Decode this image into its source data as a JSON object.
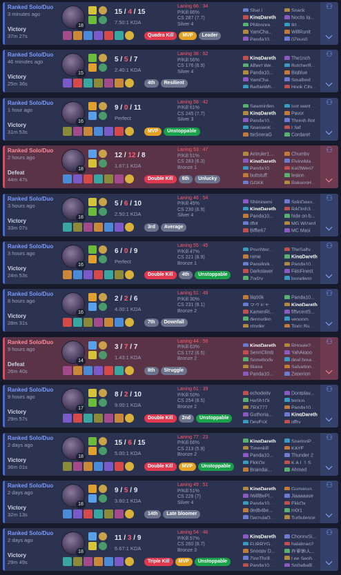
{
  "player_name": "KingDareth",
  "colors": {
    "win": "#4b6bd6",
    "loss": "#d84d62",
    "kill_badge": "#e0394f",
    "mvp_badge": "#e3a224",
    "positive_badge": "#1aa04a",
    "neutral_badge": "#6b728c"
  },
  "matches": [
    {
      "queue": "Ranked Solo/Duo",
      "ago": "3 minutes ago",
      "result": "Victory",
      "duration": "37m 27s",
      "level": "18",
      "k": "15",
      "d": "4",
      "a": "15",
      "kda": "7.50:1 KDA",
      "laning": "Laning 66 : 34",
      "pkill": "P/Kill 86%",
      "cs": "CS 287 (7.7)",
      "rank": "Silver 4",
      "badges": [
        {
          "t": "Quadra Kill",
          "c": "red"
        },
        {
          "t": "MVP",
          "c": "gold"
        },
        {
          "t": "Leader",
          "c": "grey"
        }
      ],
      "team1": [
        "ShaLi",
        "KingDareth",
        "Philosora...",
        "YamCha...",
        "Panda10..."
      ],
      "team2": [
        "Snack",
        "Noctis Ig...",
        "Ikt...",
        "WillRunIt",
        "0Zeus0"
      ]
    },
    {
      "queue": "Ranked Solo/Duo",
      "ago": "46 minutes ago",
      "result": "Victory",
      "duration": "25m 36s",
      "level": "15",
      "k": "5",
      "d": "5",
      "a": "7",
      "kda": "2.40:1 KDA",
      "laning": "Laning 38 : 62",
      "pkill": "P/Kill 56%",
      "cs": "CS 176 (6.9)",
      "rank": "Silver 4",
      "badges": [
        {
          "t": "4th",
          "c": "grey"
        },
        {
          "t": "Resilient",
          "c": "grey"
        }
      ],
      "team1": [
        "KingDareth",
        "Albert We...",
        "Panda10...",
        "YamCha...",
        "BarbieWh..."
      ],
      "team2": [
        "The1nch",
        "ButcherB...",
        "Bigblue",
        "Smallred",
        "Hook City..."
      ]
    },
    {
      "queue": "Ranked Solo/Duo",
      "ago": "1 hour ago",
      "result": "Victory",
      "duration": "31m 53s",
      "level": "16",
      "k": "9",
      "d": "0",
      "a": "11",
      "kda": "Perfect",
      "laning": "Laning 58 : 42",
      "pkill": "P/Kill 61%",
      "cs": "CS 245 (7.7)",
      "rank": "Silver 3",
      "badges": [
        {
          "t": "MVP",
          "c": "gold"
        },
        {
          "t": "Unstoppable",
          "c": "green"
        }
      ],
      "team1": [
        "Sawmirden",
        "KingDareth",
        "Panda10...",
        "SpanianK...",
        "tteSneraG"
      ],
      "team2": [
        "just want ...",
        "Pavor",
        "Thresh Bot",
        "L3af",
        "Cordaret"
      ]
    },
    {
      "queue": "Ranked Solo/Duo",
      "ago": "2 hours ago",
      "result": "Defeat",
      "duration": "44m 47s",
      "level": "18",
      "k": "12",
      "d": "12",
      "a": "8",
      "kda": "1.67:1 KDA",
      "laning": "Laning 53 : 47",
      "pkill": "P/Kill 51%",
      "cs": "CS 283 (6.3)",
      "rank": "Bronze 1",
      "badges": [
        {
          "t": "Double Kill",
          "c": "red"
        },
        {
          "t": "6th",
          "c": "grey"
        },
        {
          "t": "Unlucky",
          "c": "grey"
        }
      ],
      "team1": [
        "Antruler1...",
        "KingDareth",
        "Panda10...",
        "buttstuff",
        "GGKK"
      ],
      "team2": [
        "Chumby",
        "FlyingMa...",
        "Kai3Wen2",
        "legion",
        "RakansH..."
      ]
    },
    {
      "queue": "Ranked Solo/Duo",
      "ago": "3 hours ago",
      "result": "Victory",
      "duration": "33m 07s",
      "level": "18",
      "k": "5",
      "d": "6",
      "a": "10",
      "kda": "2.50:1 KDA",
      "laning": "Laning 46 : 54",
      "pkill": "P/Kill 45%",
      "cs": "CS 230 (6.9)",
      "rank": "Silver 4",
      "badges": [
        {
          "t": "3rd",
          "c": "grey"
        },
        {
          "t": "Average",
          "c": "grey"
        }
      ],
      "team1": [
        "Shiinigami",
        "KingDareth",
        "Panda10...",
        "dfgt",
        "Biffie67"
      ],
      "team2": [
        "SoloDaxu...",
        "RADish3...",
        "hide on b...",
        "MG Wizard",
        "MC Masi"
      ]
    },
    {
      "queue": "Ranked Solo/Duo",
      "ago": "3 hours ago",
      "result": "Victory",
      "duration": "24m 53s",
      "level": "16",
      "k": "6",
      "d": "0",
      "a": "9",
      "kda": "Perfect",
      "laning": "Laning 55 : 45",
      "pkill": "P/Kill 47%",
      "cs": "CS 221 (8.9)",
      "rank": "Bronze 1",
      "badges": [
        {
          "t": "Double Kill",
          "c": "red"
        },
        {
          "t": "4th",
          "c": "grey"
        },
        {
          "t": "Unstoppable",
          "c": "green"
        }
      ],
      "team1": [
        "Psychtec...",
        "rome",
        "Parwilork...",
        "Darkslayer",
        "Zodzy"
      ],
      "team2": [
        "TheSalty...",
        "KingDareth",
        "Panda10...",
        "FijisFinest",
        "looselegs"
      ]
    },
    {
      "queue": "Ranked Solo/Duo",
      "ago": "8 hours ago",
      "result": "Victory",
      "duration": "28m 31s",
      "level": "16",
      "k": "2",
      "d": "2",
      "a": "6",
      "kda": "4.00:1 KDA",
      "laning": "Laning 51 : 49",
      "pkill": "P/Kill 30%",
      "cs": "CS 231 (8.1)",
      "rank": "Bronze 2",
      "badges": [
        {
          "t": "7th",
          "c": "grey"
        },
        {
          "t": "Downfall",
          "c": "grey"
        }
      ],
      "team1": [
        "lilg00k",
        "マクドナ...",
        "KamenRi...",
        "dennyden",
        "stryder"
      ],
      "team2": [
        "Panda10...",
        "KingDareth",
        "fiftycent5...",
        "yeooom",
        "Toxic Bu..."
      ]
    },
    {
      "queue": "Ranked Solo/Duo",
      "ago": "9 hours ago",
      "result": "Defeat",
      "duration": "26m 40s",
      "level": "14",
      "k": "3",
      "d": "7",
      "a": "7",
      "kda": "1.43:1 KDA",
      "laning": "Laning 44 : 56",
      "pkill": "P/Kill 63%",
      "cs": "CS 172 (6.5)",
      "rank": "Bronze 2",
      "badges": [
        {
          "t": "8th",
          "c": "grey"
        },
        {
          "t": "Struggle",
          "c": "grey"
        }
      ],
      "team1": [
        "KingDareth",
        "SennClimb",
        "Somebody",
        "Iljiana",
        "Panda10..."
      ],
      "team2": [
        "RHowie2...",
        "YahAigoo",
        "deal brea...",
        "Salvation...",
        "Zeperion"
      ]
    },
    {
      "queue": "Ranked Solo/Duo",
      "ago": "9 hours ago",
      "result": "Victory",
      "duration": "29m 57s",
      "level": "17",
      "k": "8",
      "d": "2",
      "a": "10",
      "kda": "9.00:1 KDA",
      "laning": "Laning 61 : 39",
      "pkill": "P/Kill 50%",
      "cs": "CS 254 (8.5)",
      "rank": "Bronze 2",
      "badges": [
        {
          "t": "Double Kill",
          "c": "red"
        },
        {
          "t": "2nd",
          "c": "grey"
        },
        {
          "t": "Unstoppable",
          "c": "green"
        }
      ],
      "team1": [
        "echodeity",
        "HaSh1Qi",
        "ZRX777",
        "Guthoria...",
        "DeyEsX"
      ],
      "team2": [
        "Dontplay...",
        "tergus",
        "Panda10...",
        "KingDareth",
        "gffry"
      ]
    },
    {
      "queue": "Ranked Solo/Duo",
      "ago": "2 days ago",
      "result": "Victory",
      "duration": "36m 01s",
      "level": "18",
      "k": "15",
      "d": "6",
      "a": "15",
      "kda": "5.00:1 KDA",
      "laning": "Laning 77 : 23",
      "pkill": "P/Kill 66%",
      "cs": "CS 213 (5.9)",
      "rank": "Bronze 2",
      "badges": [
        {
          "t": "Double Kill",
          "c": "red"
        },
        {
          "t": "MVP",
          "c": "gold"
        },
        {
          "t": "Unstoppable",
          "c": "green"
        }
      ],
      "team1": [
        "KingDareth",
        "Timeskill",
        "Panda10...",
        "EkKOx",
        "Braindai..."
      ],
      "team2": [
        "SoaringP...",
        "KAYE",
        "Thunder 2",
        "K A L 1 S",
        "Ahmed"
      ]
    },
    {
      "queue": "Ranked Solo/Duo",
      "ago": "2 days ago",
      "result": "Victory",
      "duration": "32m 13s",
      "level": "18",
      "k": "9",
      "d": "5",
      "a": "9",
      "kda": "3.60:1 KDA",
      "laning": "Laning 49 : 51",
      "pkill": "P/Kill 51%",
      "cs": "CS 226 (7)",
      "rank": "Silver 4",
      "badges": [
        {
          "t": "14th",
          "c": "grey"
        },
        {
          "t": "Late bloomer",
          "c": "grey"
        }
      ],
      "team1": [
        "KingDareth",
        "IWillBePl...",
        "Panda10...",
        "dedb4be...",
        "DarzulaO..."
      ],
      "team2": [
        "Gumasus...",
        "Jiaaaaaye",
        "EkkOx",
        "m0r1",
        "Turbulence"
      ]
    },
    {
      "queue": "Ranked Solo/Duo",
      "ago": "2 days ago",
      "result": "Victory",
      "duration": "29m 49s",
      "level": "18",
      "k": "11",
      "d": "3",
      "a": "9",
      "kda": "6.67:1 KDA",
      "laning": "Laning 54 : 46",
      "pkill": "P/Kill 57%",
      "cs": "CS 260 (8.7)",
      "rank": "Bronze 3",
      "badges": [
        {
          "t": "Triple Kill",
          "c": "red"
        },
        {
          "t": "MVP",
          "c": "gold"
        },
        {
          "t": "Unstoppable",
          "c": "green"
        }
      ],
      "team1": [
        "KingDareth",
        "FURRYG...",
        "Snoopy D...",
        "ZionThrill...",
        "Panda10..."
      ],
      "team2": [
        "ChonnySi...",
        "halalman2",
        "在爱她人...",
        "Lee Seoh...",
        "Sn0wballl..."
      ]
    }
  ]
}
